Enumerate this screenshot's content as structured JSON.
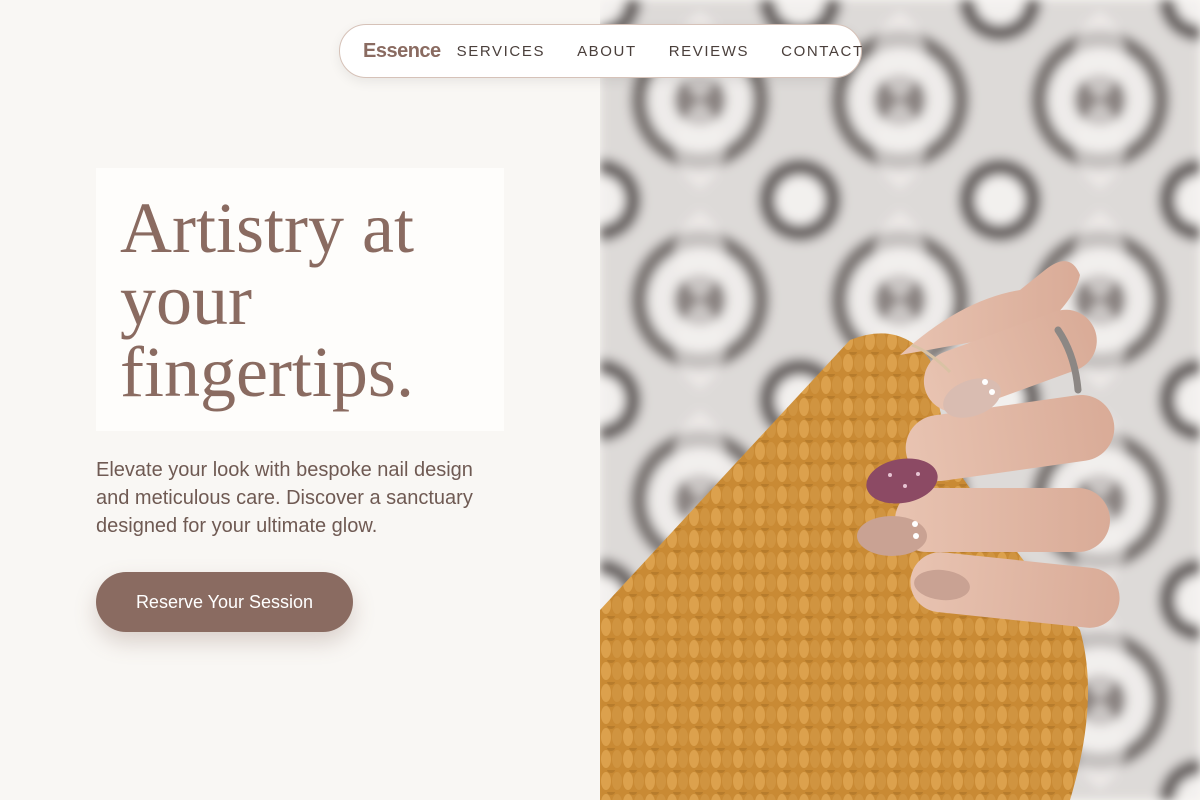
{
  "brand": {
    "name": "Essence"
  },
  "nav": {
    "links": [
      "SERVICES",
      "ABOUT",
      "REVIEWS",
      "CONTACT"
    ]
  },
  "hero": {
    "title_lines": [
      "Artistry at",
      "your",
      "fingertips."
    ],
    "subtitle": "Elevate your look with bespoke nail design and meticulous care. Discover a sanctuary designed for your ultimate glow.",
    "cta_label": "Reserve Your Session",
    "image_alt": "Hand with manicured nude and glitter nails holding a mustard knit sweater against a patterned tile background"
  },
  "colors": {
    "accent": "#8a6b61",
    "background": "#f9f7f4",
    "text_dark": "#4a3f3b",
    "sweater": "#d2963f"
  }
}
